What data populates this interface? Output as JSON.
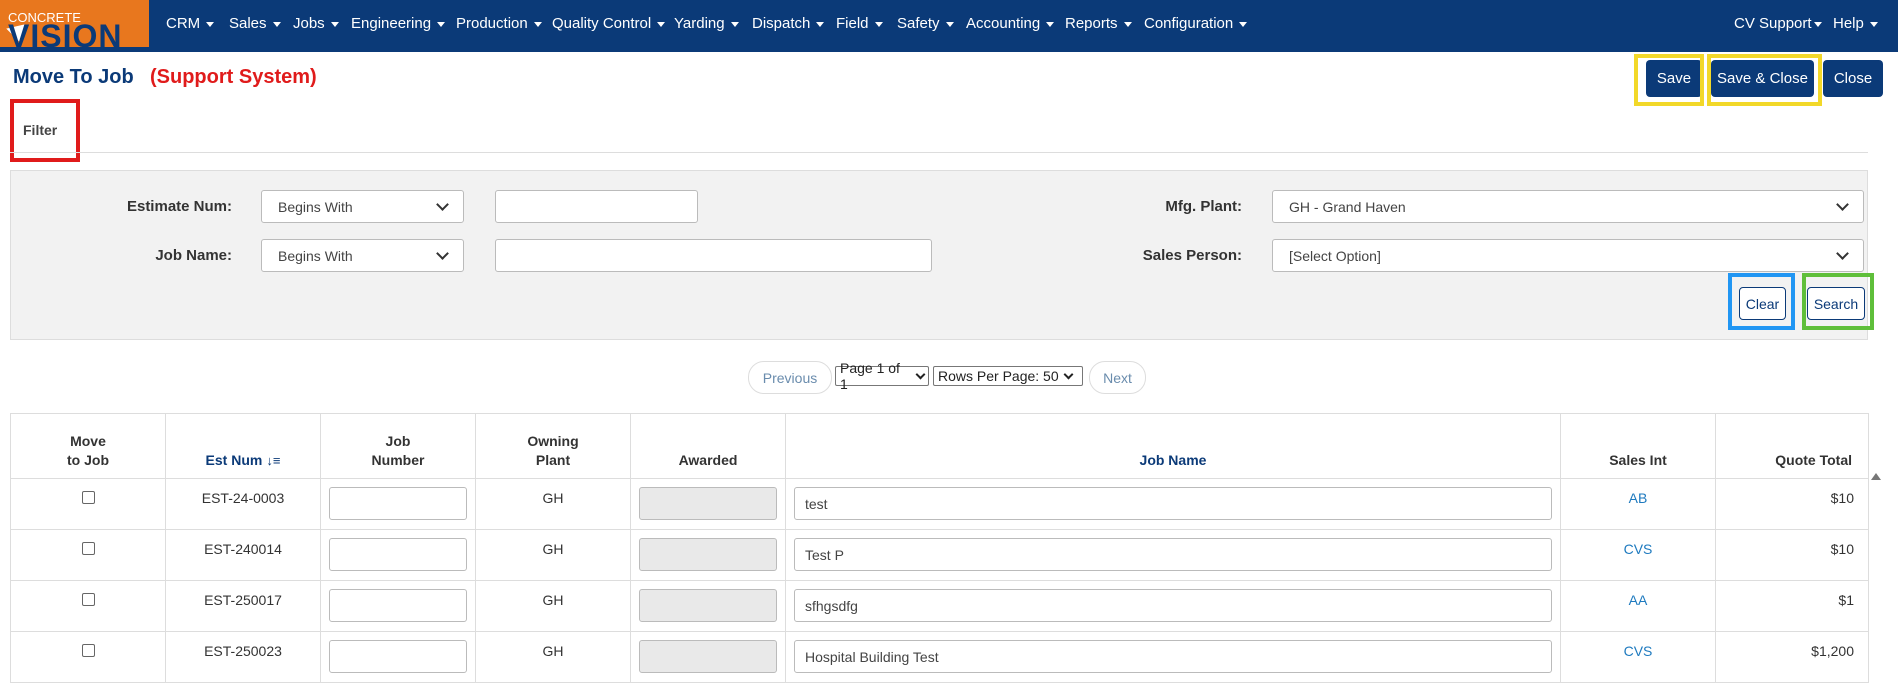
{
  "logo": {
    "small": "CONCRETE",
    "big": "VISION"
  },
  "nav": {
    "left": [
      "CRM",
      "Sales",
      "Jobs",
      "Engineering",
      "Production",
      "Quality Control",
      "Yarding",
      "Dispatch",
      "Field",
      "Safety",
      "Accounting",
      "Reports",
      "Configuration"
    ],
    "right": [
      "CV Support",
      "Help"
    ]
  },
  "page": {
    "title": "Move To Job",
    "subtitle": "(Support System)"
  },
  "actions": {
    "save": "Save",
    "save_close": "Save & Close",
    "close": "Close"
  },
  "filter": {
    "tab": "Filter",
    "estimate_num_label": "Estimate Num:",
    "estimate_num_mode": "Begins With",
    "estimate_num_value": "",
    "job_name_label": "Job Name:",
    "job_name_mode": "Begins With",
    "job_name_value": "",
    "mfg_plant_label": "Mfg. Plant:",
    "mfg_plant_value": "GH - Grand Haven",
    "sales_person_label": "Sales Person:",
    "sales_person_value": "[Select Option]",
    "clear": "Clear",
    "search": "Search"
  },
  "pager": {
    "previous": "Previous",
    "page": "Page 1 of 1",
    "rows": "Rows Per Page: 50",
    "next": "Next"
  },
  "table": {
    "headers": {
      "move_line1": "Move",
      "move_line2": "to Job",
      "est_num": "Est Num",
      "job_number_line1": "Job",
      "job_number_line2": "Number",
      "owning_line1": "Owning",
      "owning_line2": "Plant",
      "awarded": "Awarded",
      "job_name": "Job Name",
      "sales_int": "Sales Int",
      "quote_total": "Quote Total"
    },
    "rows": [
      {
        "est_num": "EST-24-0003",
        "plant": "GH",
        "job_name": "test",
        "sales_int": "AB",
        "quote_total": "$10"
      },
      {
        "est_num": "EST-240014",
        "plant": "GH",
        "job_name": "Test P",
        "sales_int": "CVS",
        "quote_total": "$10"
      },
      {
        "est_num": "EST-250017",
        "plant": "GH",
        "job_name": "sfhgsdfg",
        "sales_int": "AA",
        "quote_total": "$1"
      },
      {
        "est_num": "EST-250023",
        "plant": "GH",
        "job_name": "Hospital Building Test",
        "sales_int": "CVS",
        "quote_total": "$1,200"
      }
    ]
  },
  "colors": {
    "navy": "#0b3a78",
    "orange": "#e8771e",
    "red_highlight": "#e01b1b",
    "yellow_highlight": "#f2d829",
    "blue_highlight": "#2196f3",
    "green_highlight": "#5fbf3a"
  }
}
